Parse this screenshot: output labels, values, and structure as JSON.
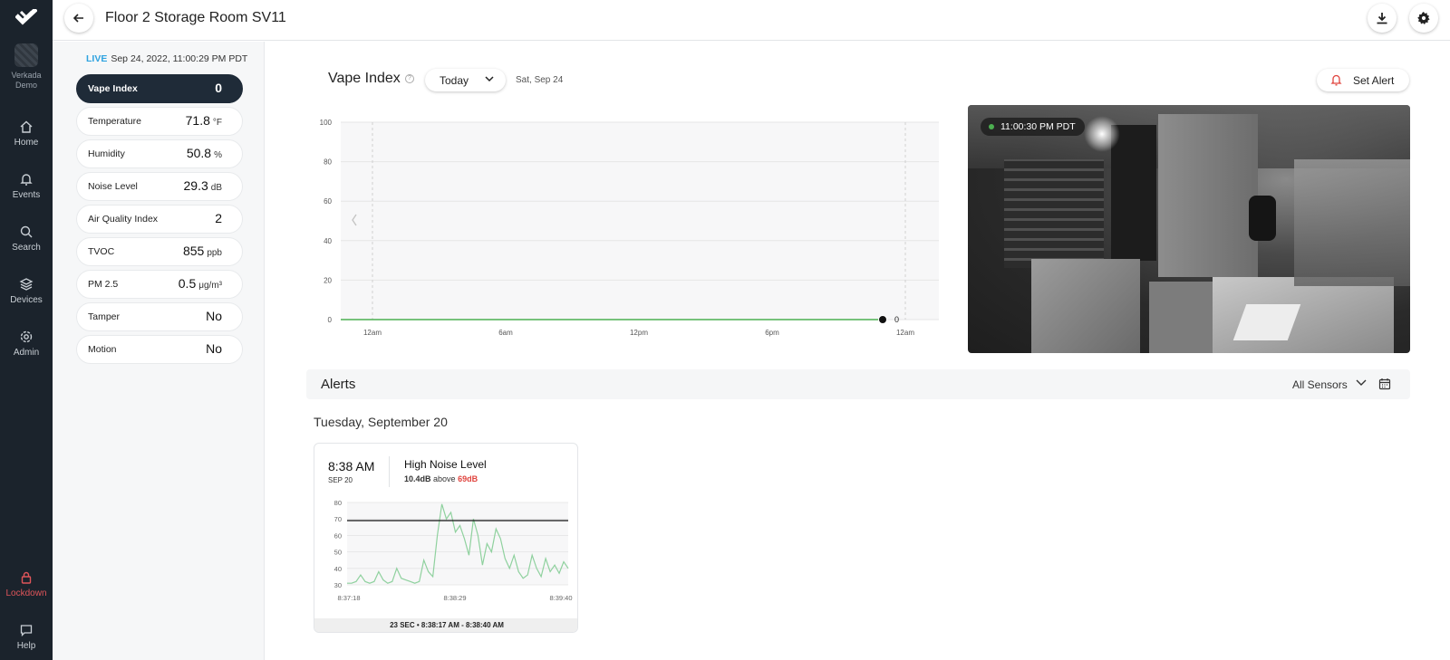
{
  "nav": {
    "org_name_line1": "Verkada",
    "org_name_line2": "Demo",
    "items": [
      {
        "label": "Home",
        "icon": "home-icon"
      },
      {
        "label": "Events",
        "icon": "bell-icon"
      },
      {
        "label": "Search",
        "icon": "search-icon"
      },
      {
        "label": "Devices",
        "icon": "devices-icon"
      },
      {
        "label": "Admin",
        "icon": "gear-icon"
      }
    ],
    "lockdown": "Lockdown",
    "help": "Help"
  },
  "header": {
    "title": "Floor 2 Storage Room SV11"
  },
  "live": {
    "badge": "LIVE",
    "timestamp": "Sep 24, 2022, 11:00:29 PM PDT"
  },
  "metrics": [
    {
      "label": "Vape Index",
      "value": "0",
      "unit": "",
      "active": true
    },
    {
      "label": "Temperature",
      "value": "71.8",
      "unit": "°F"
    },
    {
      "label": "Humidity",
      "value": "50.8",
      "unit": "%"
    },
    {
      "label": "Noise Level",
      "value": "29.3",
      "unit": "dB"
    },
    {
      "label": "Air Quality Index",
      "value": "2",
      "unit": ""
    },
    {
      "label": "TVOC",
      "value": "855",
      "unit": "ppb"
    },
    {
      "label": "PM 2.5",
      "value": "0.5",
      "unit": "μg/m³"
    },
    {
      "label": "Tamper",
      "value": "No",
      "unit": ""
    },
    {
      "label": "Motion",
      "value": "No",
      "unit": ""
    }
  ],
  "chart_header": {
    "title": "Vape Index",
    "range_select": "Today",
    "date": "Sat, Sep 24",
    "set_alert": "Set Alert"
  },
  "chart_data": [
    {
      "type": "line",
      "title": "Vape Index",
      "x": [
        "12am",
        "6am",
        "12pm",
        "6pm",
        "12am"
      ],
      "yticks": [
        0,
        20,
        40,
        60,
        80,
        100
      ],
      "ylim": [
        0,
        100
      ],
      "series": [
        {
          "values": [
            0,
            0,
            0,
            0,
            0
          ],
          "color": "#4caf50"
        }
      ],
      "end_label": "0",
      "grid": true
    },
    {
      "type": "line",
      "title": "High Noise Level",
      "x": [
        "8:37:18",
        "8:38:29",
        "8:39:40"
      ],
      "yticks": [
        30,
        40,
        50,
        60,
        70,
        80
      ],
      "ylim": [
        30,
        80
      ],
      "threshold": 69,
      "series": [
        {
          "values": [
            31,
            31,
            32,
            36,
            32,
            31,
            32,
            38,
            33,
            31,
            32,
            40,
            34,
            33,
            32,
            31,
            32,
            45,
            38,
            35,
            60,
            79,
            70,
            74,
            62,
            66,
            58,
            48,
            70,
            60,
            42,
            55,
            50,
            64,
            58,
            46,
            40,
            48,
            38,
            34,
            36,
            48,
            40,
            35,
            46,
            38,
            42,
            37,
            44,
            40
          ],
          "color": "#8fd19e"
        }
      ]
    }
  ],
  "camera": {
    "timestamp": "11:00:30 PM PDT"
  },
  "alerts": {
    "title": "Alerts",
    "filter": "All Sensors",
    "day_header": "Tuesday, September 20",
    "card": {
      "time": "8:38 AM",
      "date": "SEP 20",
      "event": "High Noise Level",
      "amount": "10.4dB",
      "above": "above",
      "threshold": "69dB",
      "duration": "23 SEC",
      "range": "8:38:17 AM - 8:38:40 AM"
    }
  }
}
